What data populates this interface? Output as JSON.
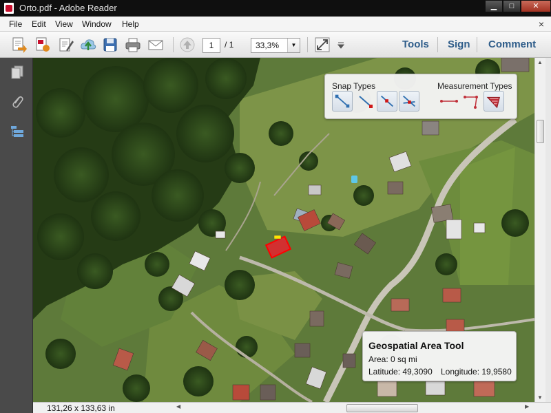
{
  "window": {
    "title": "Orto.pdf - Adobe Reader",
    "icon": "pdf-icon",
    "buttons": {
      "minimize": "▁",
      "maximize": "□",
      "close": "✕"
    }
  },
  "menubar": {
    "items": [
      "File",
      "Edit",
      "View",
      "Window",
      "Help"
    ],
    "close_doc": "×"
  },
  "toolbar": {
    "icons": [
      "create-icon",
      "convert-icon",
      "edit-icon",
      "upload-icon",
      "save-icon",
      "print-icon",
      "email-icon",
      "prev-page-icon",
      "fit-page-icon",
      "more-icon"
    ],
    "page_current": "1",
    "page_total": "/ 1",
    "zoom": "33,3%",
    "links": [
      "Tools",
      "Sign",
      "Comment"
    ],
    "link_color": "#2f5d8a"
  },
  "left_panel": {
    "icons": [
      "pages-icon",
      "attachments-icon",
      "layers-icon"
    ]
  },
  "measure_panel": {
    "snap_label": "Snap Types",
    "measurement_label": "Measurement Types",
    "snap_icons": [
      "snap-endpoint-icon",
      "snap-midpoint-icon",
      "snap-path-icon",
      "snap-intersection-icon"
    ],
    "measure_icons": [
      "distance-icon",
      "perimeter-icon",
      "area-icon"
    ],
    "selected_measure": "area-icon"
  },
  "geo_panel": {
    "title": "Geospatial Area Tool",
    "area": "Area: 0 sq mi",
    "latitude": "Latitude: 49,3090",
    "longitude": "Longitude: 19,9580"
  },
  "status": {
    "dimensions": "131,26 x 133,63 in"
  }
}
